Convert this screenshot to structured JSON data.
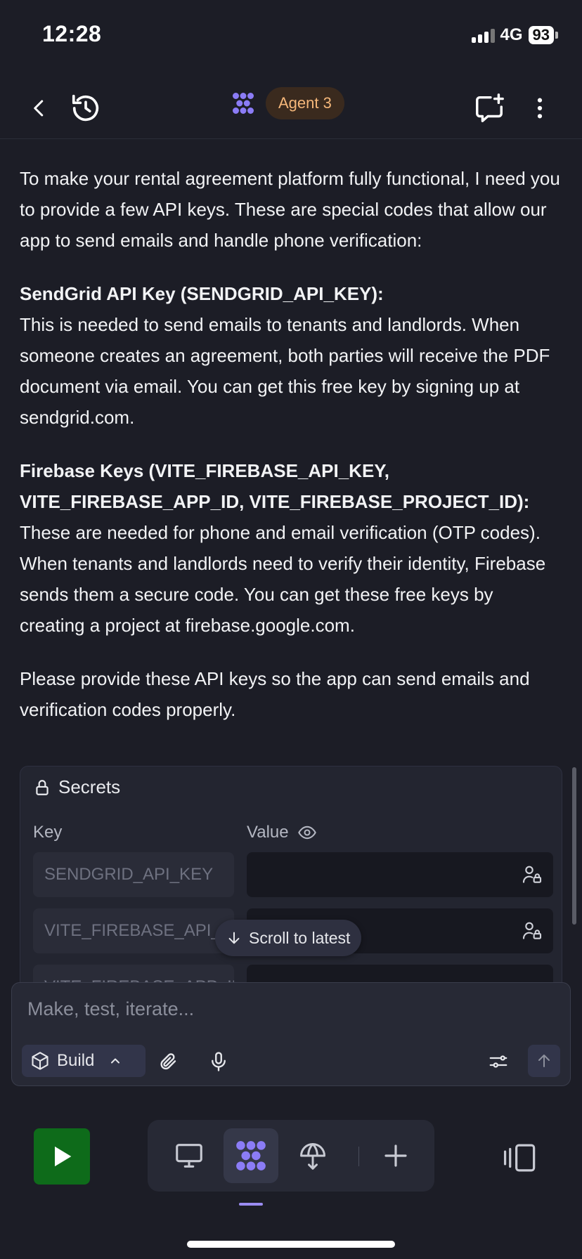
{
  "status_bar": {
    "time": "12:28",
    "network": "4G",
    "battery": "93"
  },
  "header": {
    "agent_label": "Agent 3"
  },
  "message": {
    "intro": "To make your rental agreement platform fully functional, I need you to provide a few API keys. These are special codes that allow our app to send emails and handle phone verification:",
    "sendgrid_title": "SendGrid API Key (SENDGRID_API_KEY):",
    "sendgrid_body": "This is needed to send emails to tenants and landlords. When someone creates an agreement, both parties will receive the PDF document via email. You can get this free key by signing up at sendgrid.com.",
    "firebase_title": "Firebase Keys (VITE_FIREBASE_API_KEY, VITE_FIREBASE_APP_ID, VITE_FIREBASE_PROJECT_ID):",
    "firebase_body": "These are needed for phone and email verification (OTP codes). When tenants and landlords need to verify their identity, Firebase sends them a secure code. You can get these free keys by creating a project at firebase.google.com.",
    "closing": "Please provide these API keys so the app can send emails and verification codes properly."
  },
  "secrets": {
    "title": "Secrets",
    "key_header": "Key",
    "value_header": "Value",
    "rows": [
      {
        "key": "SENDGRID_API_KEY",
        "value": ""
      },
      {
        "key": "VITE_FIREBASE_API_KEY",
        "value": ""
      },
      {
        "key": "VITE_FIREBASE_APP_ID",
        "value": ""
      }
    ]
  },
  "scroll_to_latest": "Scroll to latest",
  "composer": {
    "placeholder": "Make, test, iterate...",
    "mode": "Build"
  },
  "colors": {
    "accent": "#8b7cf6",
    "agent_badge_bg": "#3a2a1e",
    "agent_badge_text": "#f5b77a",
    "run_green": "#0e6b1a"
  }
}
